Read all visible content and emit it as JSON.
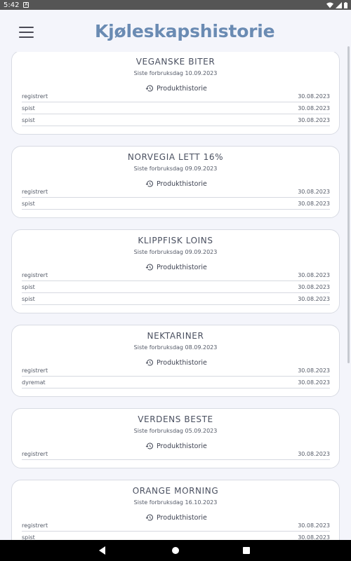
{
  "status_bar": {
    "time": "5:42",
    "notification_glyph": "A",
    "icons": [
      "wifi-icon",
      "signal-icon",
      "battery-icon"
    ]
  },
  "app_bar": {
    "title": "Kjøleskapshistorie"
  },
  "colors": {
    "title": "#6a8bb3",
    "background": "#f4f5fb",
    "card": "#ffffff"
  },
  "history_button_label": "Produkthistorie",
  "products": [
    {
      "name": "VEGANSKE BITER",
      "subtitle": "Siste forbruksdag 10.09.2023",
      "history_label": "Produkthistorie",
      "events": [
        {
          "status": "registrert",
          "date": "30.08.2023"
        },
        {
          "status": "spist",
          "date": "30.08.2023"
        },
        {
          "status": "spist",
          "date": "30.08.2023"
        }
      ]
    },
    {
      "name": "NORVEGIA LETT 16%",
      "subtitle": "Siste forbruksdag 09.09.2023",
      "history_label": "Produkthistorie",
      "events": [
        {
          "status": "registrert",
          "date": "30.08.2023"
        },
        {
          "status": "spist",
          "date": "30.08.2023"
        }
      ]
    },
    {
      "name": "KLIPPFISK LOINS",
      "subtitle": "Siste forbruksdag 09.09.2023",
      "history_label": "Produkthistorie",
      "events": [
        {
          "status": "registrert",
          "date": "30.08.2023"
        },
        {
          "status": "spist",
          "date": "30.08.2023"
        },
        {
          "status": "spist",
          "date": "30.08.2023"
        }
      ]
    },
    {
      "name": "NEKTARINER",
      "subtitle": "Siste forbruksdag 08.09.2023",
      "history_label": "Produkthistorie",
      "events": [
        {
          "status": "registrert",
          "date": "30.08.2023"
        },
        {
          "status": "dyremat",
          "date": "30.08.2023"
        }
      ]
    },
    {
      "name": "VERDENS BESTE",
      "subtitle": "Siste forbruksdag 05.09.2023",
      "history_label": "Produkthistorie",
      "events": [
        {
          "status": "registrert",
          "date": "30.08.2023"
        }
      ]
    },
    {
      "name": "ORANGE MORNING",
      "subtitle": "Siste forbruksdag 16.10.2023",
      "history_label": "Produkthistorie",
      "events": [
        {
          "status": "registrert",
          "date": "30.08.2023"
        },
        {
          "status": "spist",
          "date": "30.08.2023"
        }
      ]
    }
  ]
}
